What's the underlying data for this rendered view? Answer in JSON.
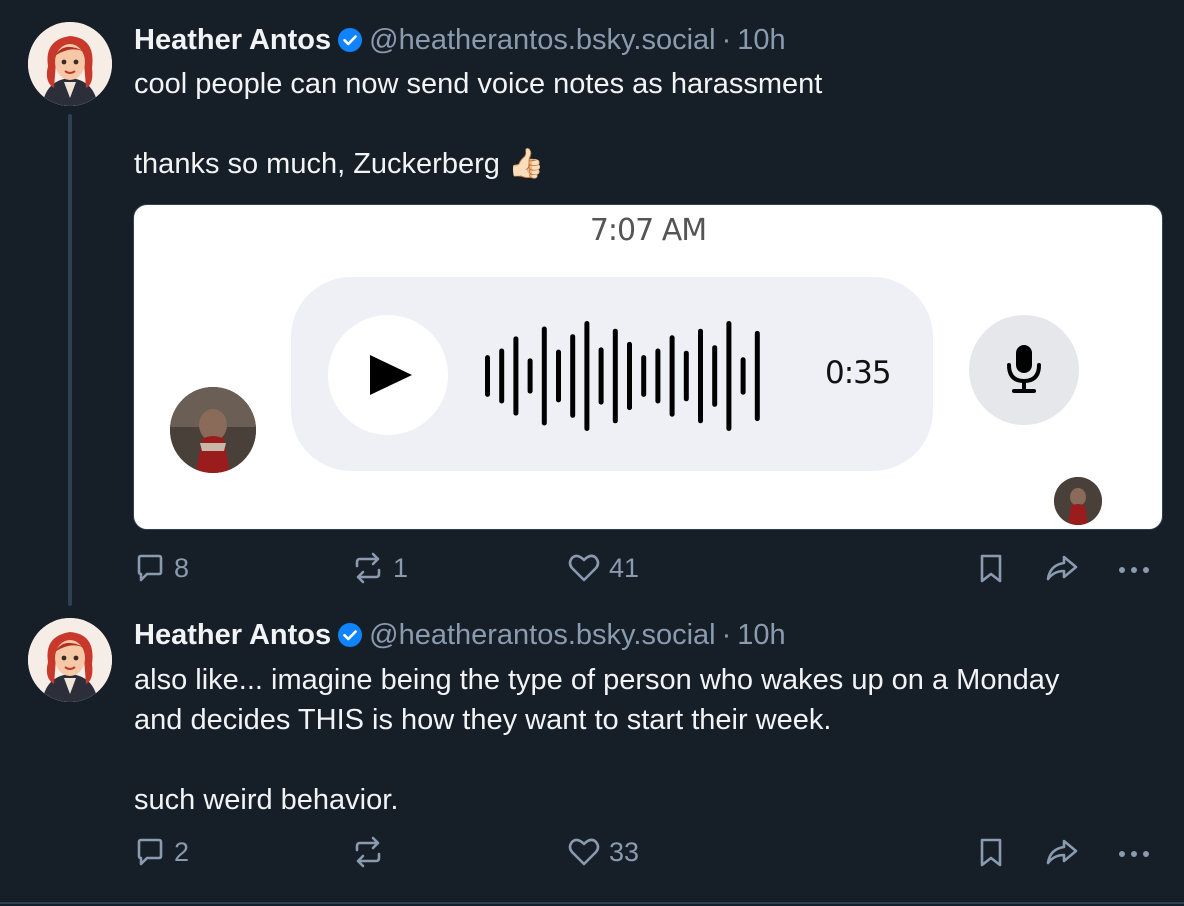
{
  "colors": {
    "background": "#161e27",
    "text": "#f1f3f5",
    "muted": "#8a9bb0",
    "verified": "#1083fe",
    "thread_line": "#2e4052"
  },
  "posts": [
    {
      "author": "Heather Antos",
      "handle": "@heatherantos.bsky.social",
      "separator": "·",
      "time": "10h",
      "text": "cool people can now send voice notes as harassment\n\nthanks so much, Zuckerberg 👍🏻",
      "media": {
        "type": "voice-message-screenshot",
        "timestamp": "7:07 AM",
        "duration": "0:35",
        "play_icon": "play-icon",
        "mic_icon": "microphone-icon",
        "waveform_levels": [
          0.38,
          0.5,
          0.72,
          0.32,
          0.9,
          0.48,
          0.76,
          1.0,
          0.52,
          0.86,
          0.62,
          0.38,
          0.5,
          0.74,
          0.46,
          0.86,
          0.56,
          1.0,
          0.34,
          0.82
        ]
      },
      "actions": {
        "reply_count": "8",
        "repost_count": "1",
        "like_count": "41"
      }
    },
    {
      "author": "Heather Antos",
      "handle": "@heatherantos.bsky.social",
      "separator": "·",
      "time": "10h",
      "text": "also like... imagine being the type of person who wakes up on a Monday\nand decides THIS is how they want to start their week.\n\nsuch weird behavior.",
      "actions": {
        "reply_count": "2",
        "repost_count": "",
        "like_count": "33"
      }
    }
  ]
}
